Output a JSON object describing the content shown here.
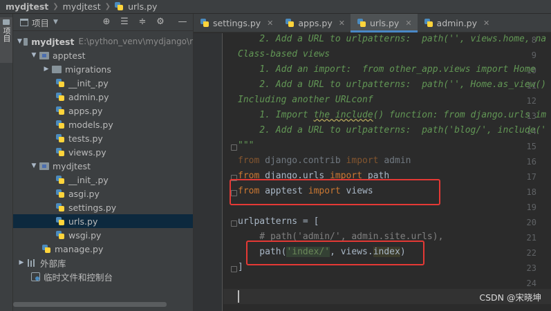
{
  "breadcrumb": {
    "project": "mydjtest",
    "folder": "mydjtest",
    "file": "urls.py"
  },
  "tool_strip": {
    "project_tab": "项目"
  },
  "project_panel": {
    "title": "项目",
    "buttons": [
      "locate-icon",
      "expand-all-icon",
      "collapse-all-icon",
      "settings-icon",
      "hide-icon"
    ],
    "tree": [
      {
        "label": "mydjtest",
        "path": "E:\\python_venv\\mydjango\\r",
        "type": "root",
        "expanded": true
      },
      {
        "label": "apptest",
        "type": "module",
        "expanded": true
      },
      {
        "label": "migrations",
        "type": "folder",
        "expanded": false
      },
      {
        "label": "__init_.py",
        "type": "py"
      },
      {
        "label": "admin.py",
        "type": "py"
      },
      {
        "label": "apps.py",
        "type": "py"
      },
      {
        "label": "models.py",
        "type": "py"
      },
      {
        "label": "tests.py",
        "type": "py"
      },
      {
        "label": "views.py",
        "type": "py"
      },
      {
        "label": "mydjtest",
        "type": "module",
        "expanded": true
      },
      {
        "label": "__init_.py",
        "type": "py"
      },
      {
        "label": "asgi.py",
        "type": "py"
      },
      {
        "label": "settings.py",
        "type": "py"
      },
      {
        "label": "urls.py",
        "type": "py",
        "selected": true
      },
      {
        "label": "wsgi.py",
        "type": "py"
      },
      {
        "label": "manage.py",
        "type": "py"
      },
      {
        "label": "外部库",
        "type": "library",
        "expanded": false
      },
      {
        "label": "临时文件和控制台",
        "type": "scratch"
      }
    ]
  },
  "editor": {
    "tabs": [
      {
        "label": "settings.py",
        "active": false
      },
      {
        "label": "apps.py",
        "active": false
      },
      {
        "label": "urls.py",
        "active": true
      },
      {
        "label": "admin.py",
        "active": false
      }
    ],
    "line_numbers": [
      "8",
      "9",
      "10",
      "11",
      "12",
      "13",
      "14",
      "15",
      "16",
      "17",
      "18",
      "19",
      "20",
      "21",
      "22",
      "23",
      "24"
    ],
    "lines": {
      "l8": "    2. Add a URL to urlpatterns:  path('', views.home, na",
      "l9": "Class-based views",
      "l10": "    1. Add an import:  from other_app.views import Home",
      "l11": "    2. Add a URL to urlpatterns:  path('', Home.as_view()",
      "l12": "Including another URLconf",
      "l13a": "    1. Import ",
      "l13b": "the include",
      "l13c": "() function: from django.urls im",
      "l14": "    2. Add a URL to urlpatterns:  path('blog/', include('",
      "l15": "\"\"\"",
      "l16a": "from",
      "l16b": " django.contrib ",
      "l16c": "import",
      "l16d": " admin",
      "l17a": "from",
      "l17b": " django.urls ",
      "l17c": "import",
      "l17d": " path",
      "l18a": "from",
      "l18b": " apptest ",
      "l18c": "import",
      "l18d": " views",
      "l20": "urlpatterns = [",
      "l21": "    # path('admin/', admin.site.urls),",
      "l22a": "    path(",
      "l22b": "'index/'",
      "l22c": ", views.",
      "l22d": "index",
      "l22e": ")",
      "l23": "]"
    }
  },
  "colors": {
    "editor_bg": "#2b2b2b",
    "panel_bg": "#3c3f41",
    "keyword": "#cc7832",
    "docstring": "#629755",
    "string": "#6a8759",
    "comment": "#808080",
    "annotation_box": "#e53935",
    "active_tab_underline": "#4a88c7"
  },
  "watermark": "CSDN @宋晓坤"
}
